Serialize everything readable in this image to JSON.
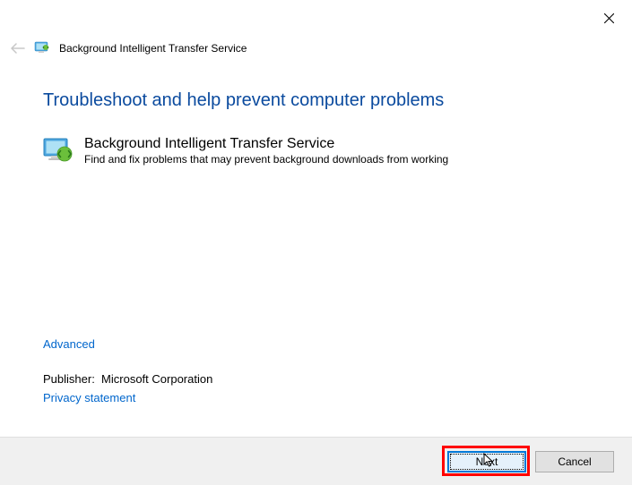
{
  "titlebar": {
    "window_title": "Background Intelligent Transfer Service"
  },
  "content": {
    "main_heading": "Troubleshoot and help prevent computer problems",
    "item_title": "Background Intelligent Transfer Service",
    "item_description": "Find and fix problems that may prevent background downloads from working",
    "advanced_link": "Advanced",
    "publisher_label": "Publisher:",
    "publisher_value": "Microsoft Corporation",
    "privacy_link": "Privacy statement"
  },
  "buttons": {
    "next": "Next",
    "cancel": "Cancel"
  }
}
